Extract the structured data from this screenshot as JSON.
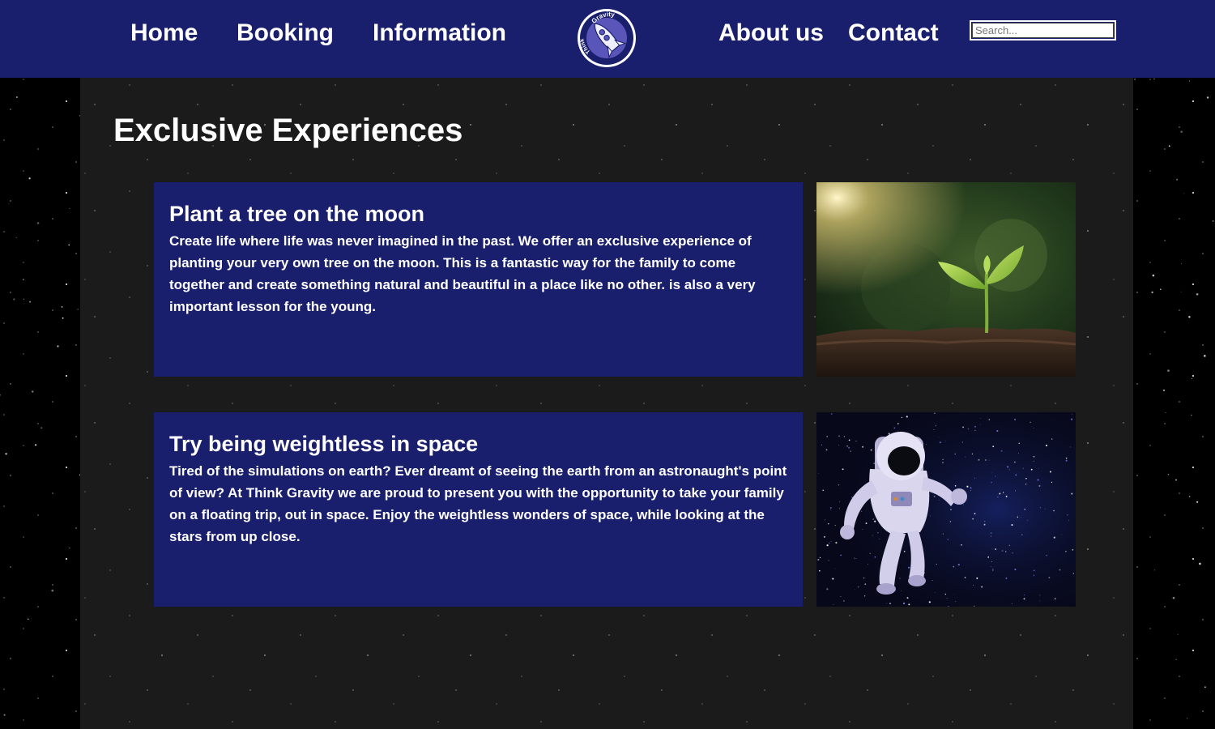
{
  "nav": {
    "links": [
      "Home",
      "Booking",
      "Information",
      "About us",
      "Contact"
    ],
    "logo_text_top": "Gravity",
    "logo_text_left": "Think",
    "search_placeholder": "Search..."
  },
  "page": {
    "title": "Exclusive Experiences"
  },
  "experiences": [
    {
      "title": "Plant a tree on the moon",
      "description": "Create life where life was never imagined in the past. We offer an exclusive experience of planting your very own tree on the moon. This is a fantastic way for the family to come together and create something natural and beautiful in a place like no other. is also a very important lesson for the young.",
      "image": "seedling-photo"
    },
    {
      "title": "Try being weightless in space",
      "description": "Tired of the simulations on earth? Ever dreamt of seeing the earth from an astronaught's point of view? At Think Gravity we are proud to present you with the opportunity to take your family on a floating trip, out in space. Enjoy the weightless wonders of space, while looking at the stars from up close.",
      "image": "astronaut-photo"
    }
  ],
  "colors": {
    "nav_background": "#1a1f6d",
    "card_background": "#1a1f6d",
    "content_background": "#1b1b1b",
    "page_background": "#000000",
    "text": "#ffffff"
  }
}
